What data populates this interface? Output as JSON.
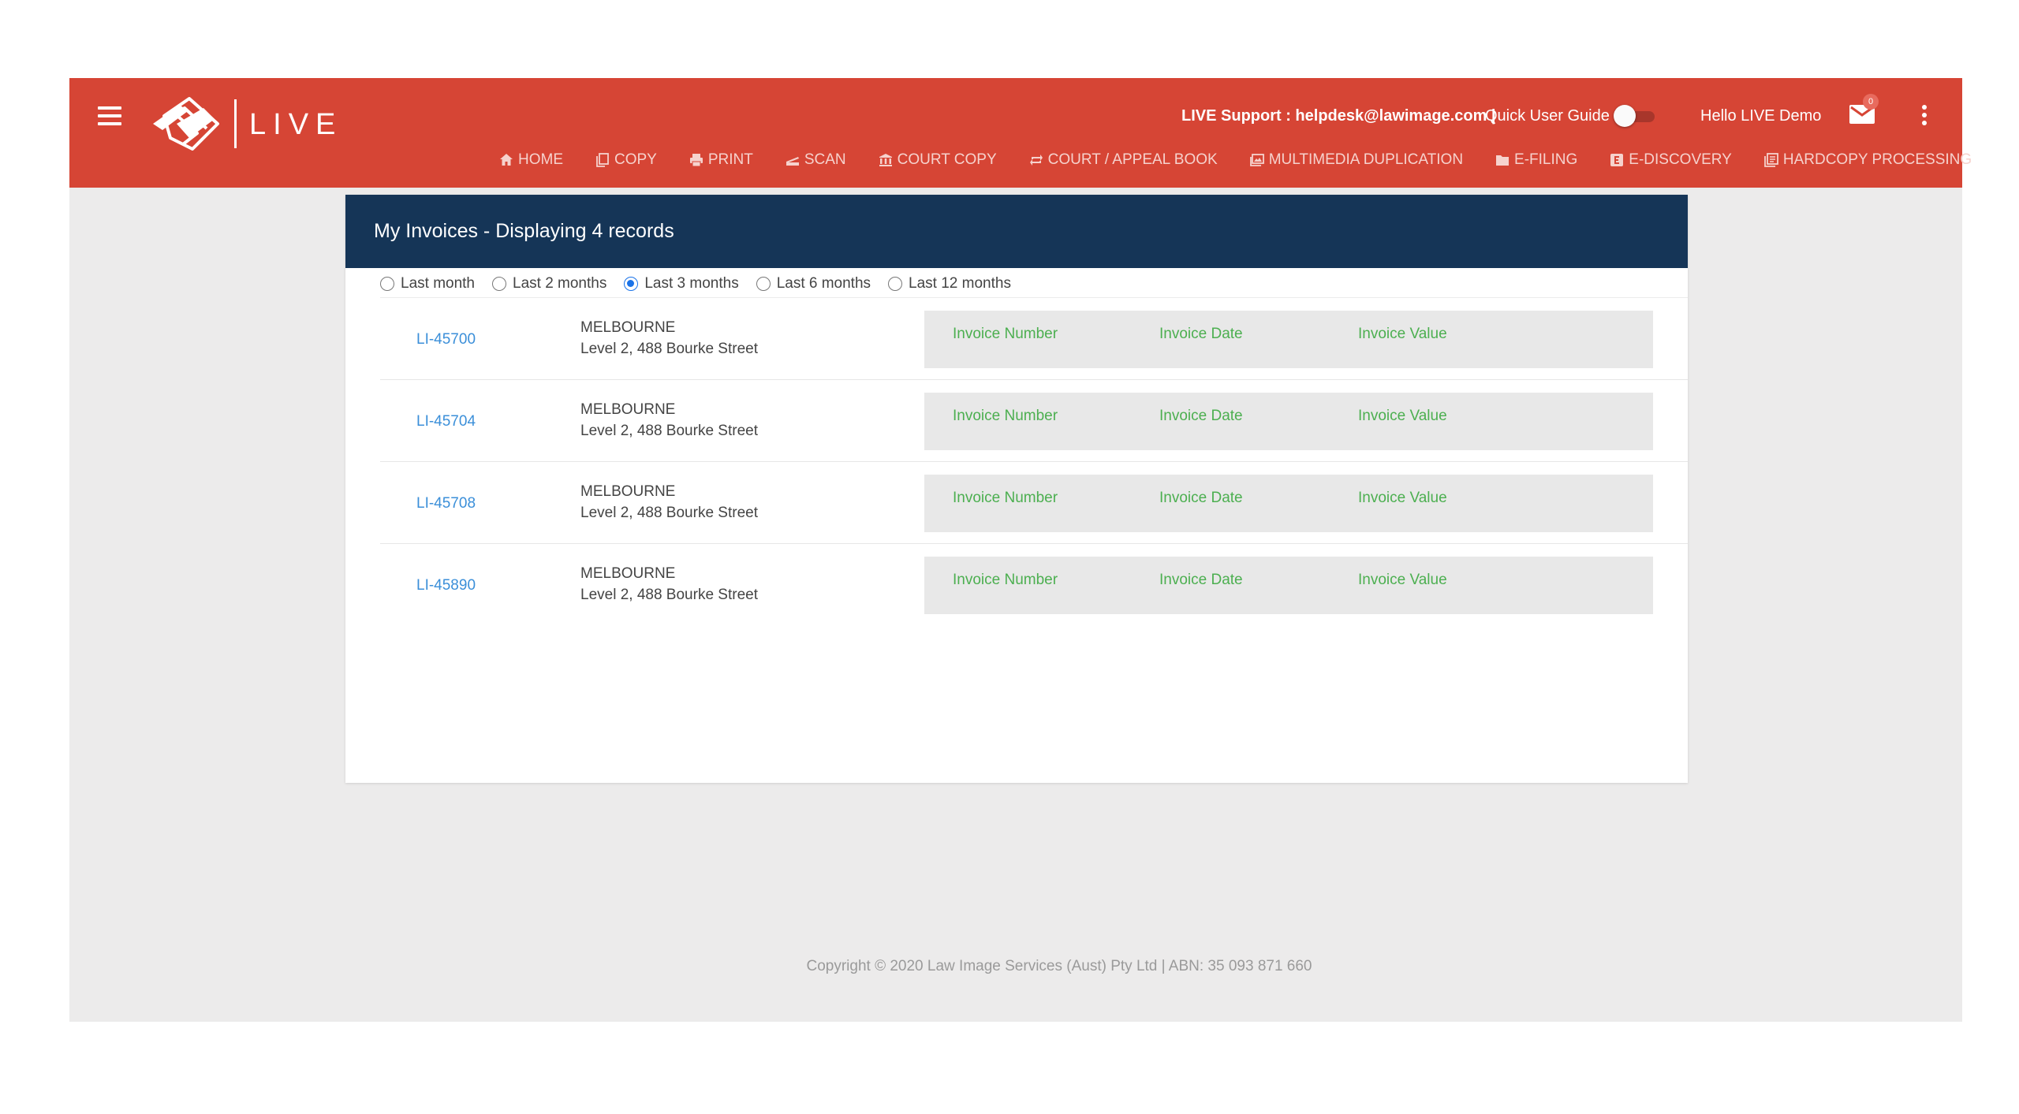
{
  "header": {
    "logo_text": "LIVE",
    "support_text": "LIVE Support : helpdesk@lawimage.com |",
    "guide_label": "Quick User Guide",
    "greeting": "Hello LIVE Demo",
    "mail_count": "0",
    "colors": {
      "topbar": "#d64535",
      "header_card": "#153557",
      "link": "#3b8fd9",
      "invoice_label": "#4caf50"
    }
  },
  "nav": [
    {
      "label": "HOME",
      "icon": "home-icon"
    },
    {
      "label": "COPY",
      "icon": "copy-icon"
    },
    {
      "label": "PRINT",
      "icon": "print-icon"
    },
    {
      "label": "SCAN",
      "icon": "scan-icon"
    },
    {
      "label": "COURT COPY",
      "icon": "court-icon"
    },
    {
      "label": "COURT / APPEAL BOOK",
      "icon": "repeat-icon"
    },
    {
      "label": "MULTIMEDIA DUPLICATION",
      "icon": "photos-icon"
    },
    {
      "label": "E-FILING",
      "icon": "folder-icon"
    },
    {
      "label": "E-DISCOVERY",
      "icon": "e-icon"
    },
    {
      "label": "HARDCOPY PROCESSING",
      "icon": "documents-icon"
    }
  ],
  "page": {
    "title": "My Invoices - Displaying 4 records",
    "filters": [
      {
        "label": "Last month",
        "selected": false
      },
      {
        "label": "Last 2 months",
        "selected": false
      },
      {
        "label": "Last 3 months",
        "selected": true
      },
      {
        "label": "Last 6 months",
        "selected": false
      },
      {
        "label": "Last 12 months",
        "selected": false
      }
    ],
    "rows": [
      {
        "id": "LI-45700",
        "city": "MELBOURNE",
        "street": "Level 2, 488 Bourke Street",
        "col1": "Invoice Number",
        "col2": "Invoice Date",
        "col3": "Invoice Value"
      },
      {
        "id": "LI-45704",
        "city": "MELBOURNE",
        "street": "Level 2, 488 Bourke Street",
        "col1": "Invoice Number",
        "col2": "Invoice Date",
        "col3": "Invoice Value"
      },
      {
        "id": "LI-45708",
        "city": "MELBOURNE",
        "street": "Level 2, 488 Bourke Street",
        "col1": "Invoice Number",
        "col2": "Invoice Date",
        "col3": "Invoice Value"
      },
      {
        "id": "LI-45890",
        "city": "MELBOURNE",
        "street": "Level 2, 488 Bourke Street",
        "col1": "Invoice Number",
        "col2": "Invoice Date",
        "col3": "Invoice Value"
      }
    ]
  },
  "footer": {
    "copyright": "Copyright © 2020 Law Image Services (Aust) Pty Ltd | ABN: 35 093 871 660"
  }
}
